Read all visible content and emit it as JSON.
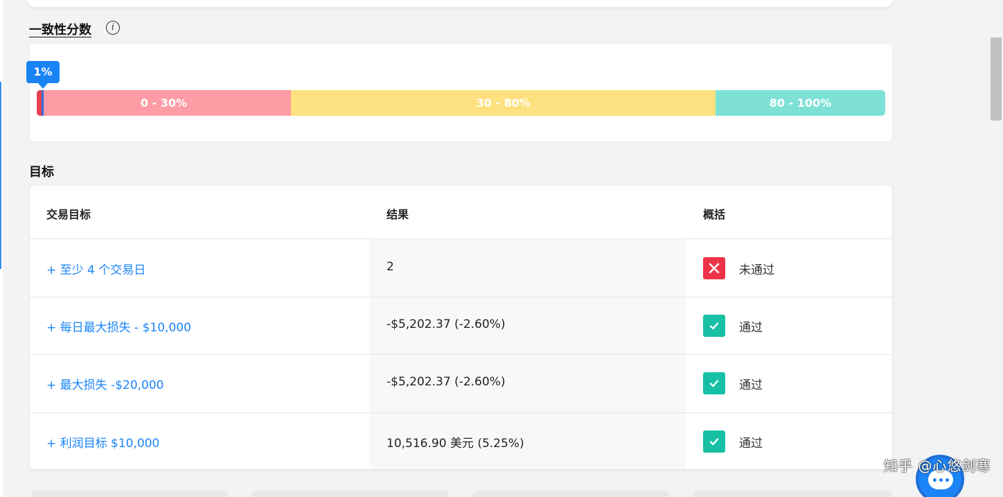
{
  "consistency": {
    "title": "一致性分数",
    "info_icon": "i",
    "score_label": "1%",
    "score_fraction": 0.01,
    "ranges": [
      {
        "label": "0 - 30%",
        "color": "#fd9ca4"
      },
      {
        "label": "30 - 80%",
        "color": "#fee180"
      },
      {
        "label": "80 - 100%",
        "color": "#7fe1d6"
      }
    ]
  },
  "goals": {
    "title": "目标",
    "headers": [
      "交易目标",
      "结果",
      "概括"
    ],
    "rows": [
      {
        "goal": "+ 至少 4 个交易日",
        "result": "2",
        "status": "未通过",
        "passed": false
      },
      {
        "goal": "+ 每日最大损失 - $10,000",
        "result": "-$5,202.37 (-2.60%)",
        "status": "通过",
        "passed": true
      },
      {
        "goal": "+ 最大损失 -$20,000",
        "result": "-$5,202.37 (-2.60%)",
        "status": "通过",
        "passed": true
      },
      {
        "goal": "+ 利润目标 $10,000",
        "result": "10,516.90 美元 (5.25%)",
        "status": "通过",
        "passed": true
      }
    ]
  },
  "watermark": "知乎 @心悠剑寒",
  "icons": {
    "fail": "close-icon",
    "pass": "check-icon",
    "chat": "chat-icon"
  },
  "colors": {
    "accent": "#1a84f7",
    "fail": "#ee3349",
    "pass": "#17c0a5"
  }
}
